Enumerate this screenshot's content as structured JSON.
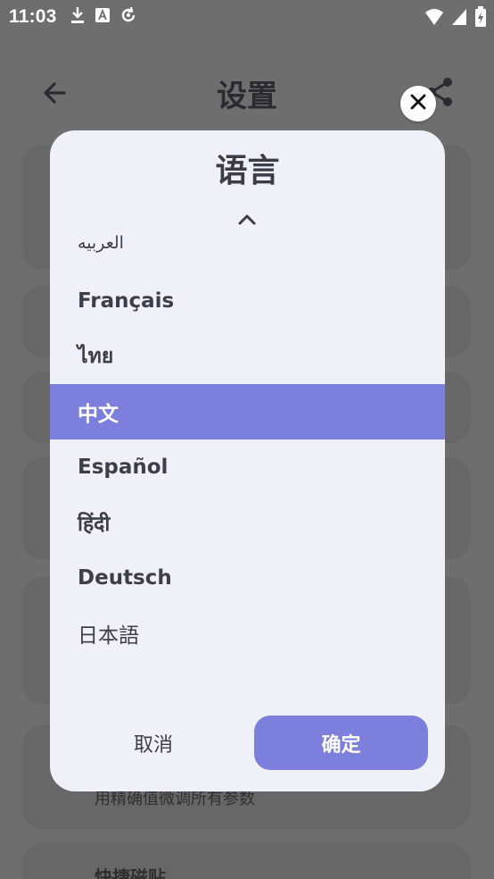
{
  "status_bar": {
    "time": "11:03",
    "left_icons": [
      "download-icon",
      "font-icon",
      "sync-icon"
    ],
    "right_icons": [
      "wifi-icon",
      "signal-icon",
      "battery-icon"
    ]
  },
  "background": {
    "title": "设置",
    "visible_subtext": "用精确值微调所有参数",
    "visible_heading": "快捷磁贴"
  },
  "dialog": {
    "title": "语言",
    "partial_item": "العربيه",
    "languages": [
      {
        "label": "Français",
        "selected": false
      },
      {
        "label": "ไทย",
        "selected": false
      },
      {
        "label": "中文",
        "selected": true
      },
      {
        "label": "Español",
        "selected": false
      },
      {
        "label": "हिंदी",
        "selected": false
      },
      {
        "label": "Deutsch",
        "selected": false
      },
      {
        "label": "日本語",
        "selected": false
      }
    ],
    "cancel_label": "取消",
    "ok_label": "确定"
  },
  "colors": {
    "accent": "#7c80dc",
    "dialog_bg": "#f0f1f8",
    "scrim": "#6e6e6e"
  }
}
